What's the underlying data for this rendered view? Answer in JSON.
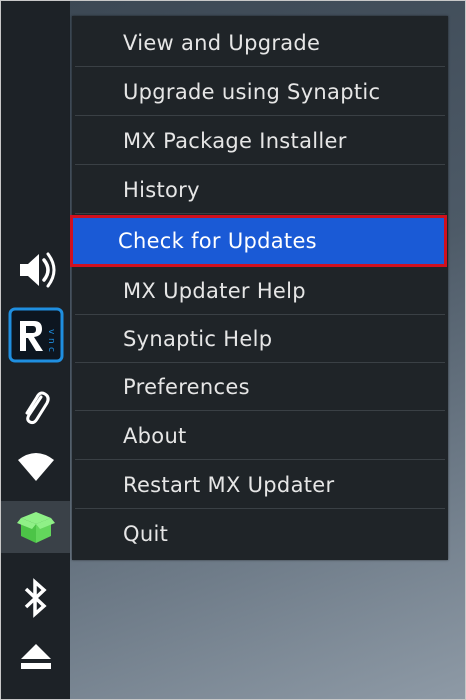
{
  "panel": {
    "icons": [
      {
        "name": "speaker-icon"
      },
      {
        "name": "vnc-icon",
        "letters": "R",
        "small_letters": "vnc"
      },
      {
        "name": "paperclip-icon"
      },
      {
        "name": "wifi-icon"
      },
      {
        "name": "mx-updater-icon",
        "active": true
      },
      {
        "name": "bluetooth-icon"
      },
      {
        "name": "eject-icon"
      }
    ]
  },
  "menu": {
    "items": [
      {
        "label": "View and Upgrade"
      },
      {
        "label": "Upgrade using Synaptic"
      },
      {
        "label": "MX Package Installer"
      },
      {
        "label": "History"
      },
      {
        "label": "Check for Updates",
        "selected": true
      },
      {
        "label": "MX Updater Help"
      },
      {
        "label": "Synaptic Help"
      },
      {
        "label": "Preferences"
      },
      {
        "label": "About"
      },
      {
        "label": "Restart MX Updater"
      },
      {
        "label": "Quit"
      }
    ]
  },
  "colors": {
    "highlight": "#1a5ad6",
    "highlight_border": "#d0101e",
    "menu_bg": "#1f2428",
    "panel_bg": "#1d2227",
    "updater_green": "#5fd35a",
    "vnc_blue": "#1f8fe0"
  }
}
